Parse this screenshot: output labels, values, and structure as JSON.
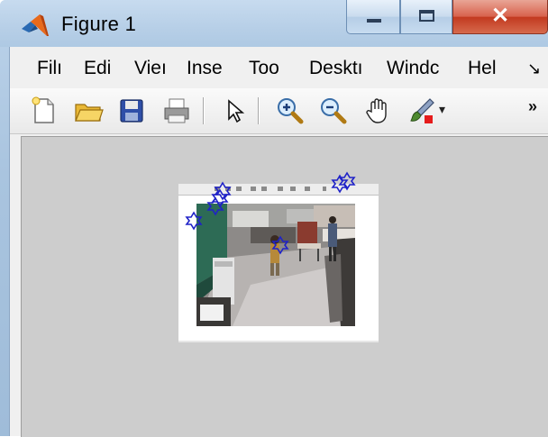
{
  "window": {
    "title": "Figure 1",
    "controls": {
      "minimize": "minimize",
      "maximize": "maximize",
      "close": "close"
    }
  },
  "menubar": {
    "items": [
      {
        "key": "file",
        "label": "Filı"
      },
      {
        "key": "edit",
        "label": "Edi"
      },
      {
        "key": "view",
        "label": "Vieı"
      },
      {
        "key": "insert",
        "label": "Inse"
      },
      {
        "key": "tools",
        "label": "Too"
      },
      {
        "key": "desktop",
        "label": "Desktı"
      },
      {
        "key": "window",
        "label": "Windc"
      },
      {
        "key": "help",
        "label": "Hel"
      }
    ],
    "overflow_glyph": "↘"
  },
  "toolbar": {
    "icons": [
      "new-figure-icon",
      "open-file-icon",
      "save-icon",
      "print-icon",
      "select-arrow-icon",
      "zoom-in-icon",
      "zoom-out-icon",
      "pan-hand-icon",
      "brush-icon"
    ],
    "dropdown_glyph": "▾",
    "more_glyph": "»"
  },
  "figure": {
    "content": "axes-with-image-and-star-markers",
    "marker_color": "#1f22c8",
    "marker_shape": "hexagram"
  },
  "colors": {
    "title_bar": "#b7cfe7",
    "close_button": "#c2391f",
    "figure_background": "#cdcdcd"
  }
}
